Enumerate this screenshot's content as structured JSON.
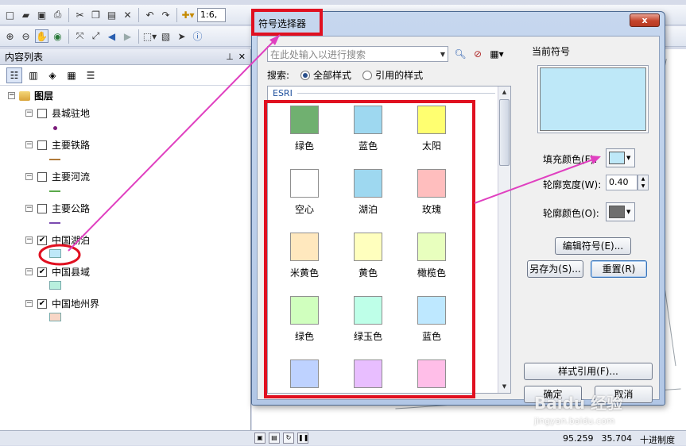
{
  "toolbar": {
    "scale_value": "1:6,",
    "icons": [
      "new-icon",
      "open-icon",
      "save-icon",
      "print-icon",
      "cut-icon",
      "copy-icon",
      "paste-icon",
      "delete-icon",
      "undo-icon",
      "redo-icon",
      "add-data-icon"
    ]
  },
  "toolbar2": {
    "icons": [
      "zoom-in-icon",
      "zoom-out-icon",
      "pan-icon",
      "full-extent-icon",
      "fixed-zoom-in-icon",
      "fixed-zoom-out-icon",
      "back-icon",
      "forward-icon",
      "select-features-icon",
      "clear-selection-icon",
      "select-elements-icon",
      "identify-icon"
    ]
  },
  "toc": {
    "title": "内容列表",
    "root_label": "图层",
    "layers": [
      {
        "name": "县城驻地",
        "checked": false,
        "symbol": "point",
        "color": "#7a1a7a"
      },
      {
        "name": "主要铁路",
        "checked": false,
        "symbol": "line",
        "color": "#b07a3a"
      },
      {
        "name": "主要河流",
        "checked": false,
        "symbol": "line",
        "color": "#5aa94a"
      },
      {
        "name": "主要公路",
        "checked": false,
        "symbol": "line",
        "color": "#7a4ab0"
      },
      {
        "name": "中国湖泊",
        "checked": true,
        "symbol": "fill",
        "color": "#bee8f8"
      },
      {
        "name": "中国县域",
        "checked": true,
        "symbol": "fill",
        "color": "#b8f0de"
      },
      {
        "name": "中国地州界",
        "checked": true,
        "symbol": "fill",
        "color": "#f8d6c6"
      }
    ]
  },
  "dialog": {
    "title": "符号选择器",
    "close_label": "x",
    "search_placeholder": "在此处输入以进行搜索",
    "search_label": "搜索:",
    "scope_all": "全部样式",
    "scope_referenced": "引用的样式",
    "group_name": "ESRI",
    "symbols": [
      {
        "label": "绿色",
        "color": "#70b070"
      },
      {
        "label": "蓝色",
        "color": "#9ed8f0"
      },
      {
        "label": "太阳",
        "color": "#ffff70"
      },
      {
        "label": "空心",
        "color": "#ffffff"
      },
      {
        "label": "湖泊",
        "color": "#9ed8f0"
      },
      {
        "label": "玫瑰",
        "color": "#ffbebe"
      },
      {
        "label": "米黄色",
        "color": "#ffe8be"
      },
      {
        "label": "黄色",
        "color": "#ffffbe"
      },
      {
        "label": "橄榄色",
        "color": "#e8ffbe"
      },
      {
        "label": "绿色",
        "color": "#d0ffbe"
      },
      {
        "label": "绿玉色",
        "color": "#beffe8"
      },
      {
        "label": "蓝色",
        "color": "#bee8ff"
      },
      {
        "label": "",
        "color": "#bed2ff"
      },
      {
        "label": "",
        "color": "#e8beff"
      },
      {
        "label": "",
        "color": "#ffbee8"
      }
    ],
    "current_symbol_label": "当前符号",
    "current_fill_color": "#bee8f8",
    "fill_color_label": "填充颜色(F):",
    "outline_width_label": "轮廓宽度(W):",
    "outline_width_value": "0.40",
    "outline_color_label": "轮廓颜色(O):",
    "outline_color": "#6e6e6e",
    "edit_symbol_label": "编辑符号(E)...",
    "save_as_label": "另存为(S)...",
    "reset_label": "重置(R)",
    "style_references_label": "样式引用(F)...",
    "ok_label": "确定",
    "cancel_label": "取消"
  },
  "statusbar": {
    "x": "95.259",
    "y": "35.704",
    "units": "十进制度"
  },
  "watermark": {
    "text": "Baidu 经验",
    "url": "jingyan.baidu.com"
  },
  "annotation_colors": {
    "highlight_box": "#e01020",
    "arrow": "#e040c0"
  }
}
